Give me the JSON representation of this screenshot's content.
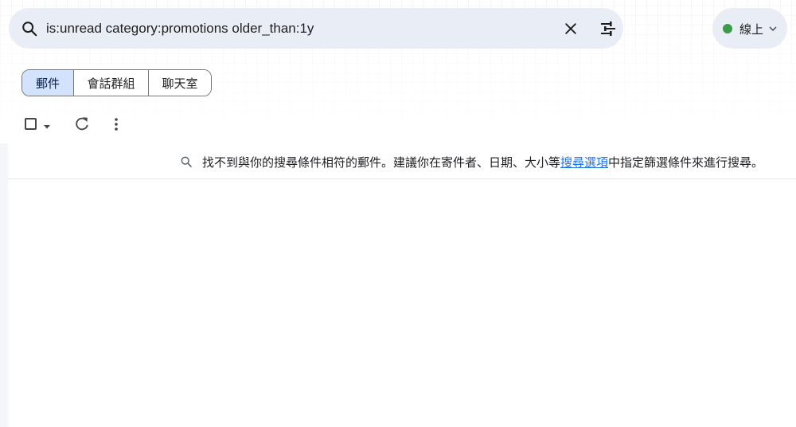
{
  "search": {
    "query": "is:unread category:promotions older_than:1y",
    "icons": {
      "search": "search-icon",
      "clear": "close-icon",
      "filter": "tune-icon"
    }
  },
  "status": {
    "label": "線上",
    "dot_color": "#3c9a4a",
    "icon": "chevron-down-icon"
  },
  "tabs": [
    {
      "label": "郵件",
      "active": true
    },
    {
      "label": "會話群組",
      "active": false
    },
    {
      "label": "聊天室",
      "active": false
    }
  ],
  "toolbar": {
    "icons": [
      "checkbox-icon",
      "caret-down-icon",
      "refresh-icon",
      "more-vert-icon"
    ]
  },
  "results": {
    "message_before": "找不到與你的搜尋條件相符的郵件。建議你在寄件者、日期、大小等",
    "link_text": "搜尋選項",
    "message_after": "中指定篩選條件來進行搜尋。",
    "link_color": "#1a73e8"
  },
  "colors": {
    "search_bar_bg": "#e9eef6",
    "active_tab_bg": "#d3e3fd"
  }
}
